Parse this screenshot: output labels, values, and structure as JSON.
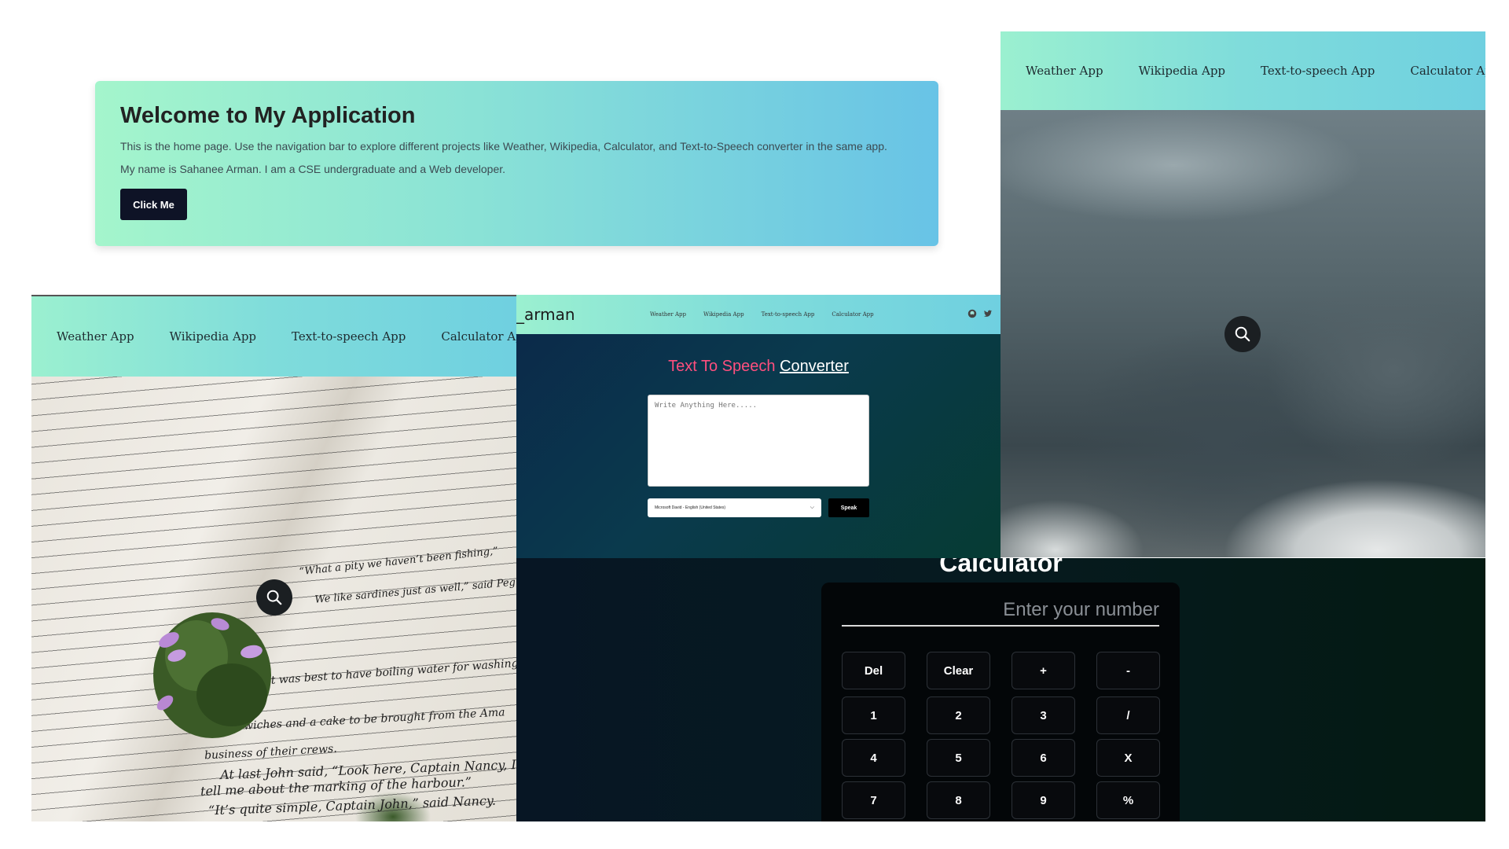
{
  "home": {
    "title": "Welcome to My Application",
    "description": "This is the home page. Use the navigation bar to explore different projects like Weather, Wikipedia, Calculator, and Text-to-Speech converter in the same app.",
    "about": "My name is Sahanee Arman. I am a CSE undergraduate and a Web developer.",
    "button_label": "Click Me"
  },
  "nav": {
    "items": [
      "Weather App",
      "Wikipedia App",
      "Text-to-speech App",
      "Calculator App"
    ]
  },
  "wiki_page": {
    "excerpts": [
      "“What a pity we haven’t been fishing,”",
      "We like sardines just as well,” said Peggy",
      "it was best to have boiling water for washing",
      "wiches and a cake to be brought from the Ama",
      "business of their crews.",
      "At last John said, “Look here, Captain Nancy, I wis",
      "tell me about the marking of the harbour.”",
      "“It’s quite simple, Captain John,” said Nancy."
    ]
  },
  "tts": {
    "logo": "_arman",
    "nav_items": [
      "Weather App",
      "Wikipedia App",
      "Text-to-speech App",
      "Calculator App"
    ],
    "title_part1": "Text To Speech",
    "title_part2": "Converter",
    "textarea_placeholder": "Write Anything Here.....",
    "voice_selected": "Microsoft David - English (United States)",
    "speak_label": "Speak"
  },
  "calculator": {
    "title": "Calculator",
    "display_placeholder": "Enter your number",
    "buttons": [
      [
        "Del",
        "Clear",
        "+",
        "-"
      ],
      [
        "1",
        "2",
        "3",
        "/"
      ],
      [
        "4",
        "5",
        "6",
        "X"
      ],
      [
        "7",
        "8",
        "9",
        "%"
      ]
    ]
  },
  "colors": {
    "tts_title_accent": "#ff4f7e",
    "button_dark": "#0e1326"
  }
}
